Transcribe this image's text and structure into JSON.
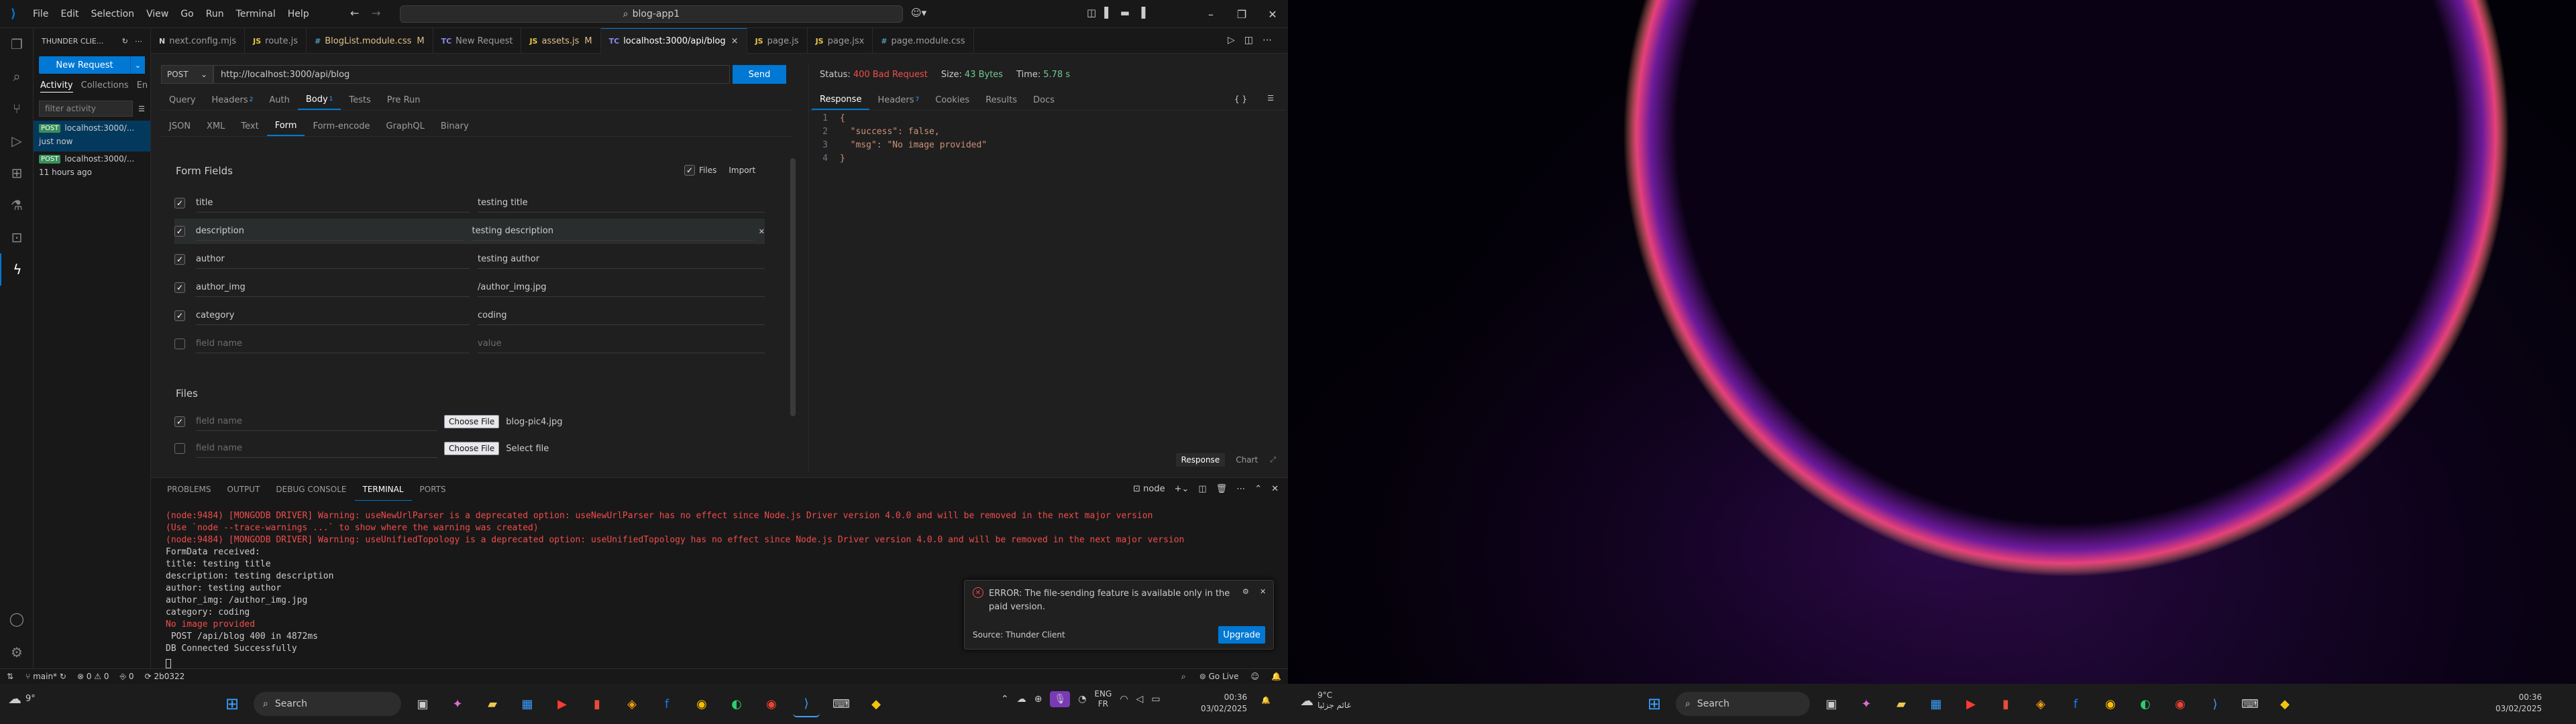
{
  "titlebar": {
    "menus": [
      "File",
      "Edit",
      "Selection",
      "View",
      "Go",
      "Run",
      "Terminal",
      "Help"
    ],
    "search": "blog-app1"
  },
  "sidebar": {
    "header": "THUNDER CLIE...",
    "new_request_label": "New Request",
    "tabs": [
      "Activity",
      "Collections",
      "En"
    ],
    "filter_placeholder": "filter activity",
    "activity": [
      {
        "method": "POST",
        "url": "localhost:3000/...",
        "time": "just now"
      },
      {
        "method": "POST",
        "url": "localhost:3000/...",
        "time": "11 hours ago"
      }
    ]
  },
  "tabs": [
    {
      "icon": "N",
      "label": "next.config.mjs",
      "mod": ""
    },
    {
      "icon": "JS",
      "label": "route.js",
      "mod": ""
    },
    {
      "icon": "#",
      "label": "BlogList.module.css",
      "mod": "M"
    },
    {
      "icon": "TC",
      "label": "New Request",
      "mod": ""
    },
    {
      "icon": "JS",
      "label": "assets.js",
      "mod": "M"
    },
    {
      "icon": "TC",
      "label": "localhost:3000/api/blog",
      "mod": "×"
    },
    {
      "icon": "JS",
      "label": "page.js",
      "mod": ""
    },
    {
      "icon": "JS",
      "label": "page.jsx",
      "mod": ""
    },
    {
      "icon": "#",
      "label": "page.module.css",
      "mod": ""
    }
  ],
  "request": {
    "method": "POST",
    "url": "http://localhost:3000/api/blog",
    "send": "Send",
    "tabs": [
      "Query",
      "Headers",
      "Auth",
      "Body",
      "Tests",
      "Pre Run"
    ],
    "headers_count": "2",
    "body_count": "1",
    "body_types": [
      "JSON",
      "XML",
      "Text",
      "Form",
      "Form-encode",
      "GraphQL",
      "Binary"
    ],
    "form_fields_title": "Form Fields",
    "files_toggle": "Files",
    "import": "Import",
    "fields": [
      {
        "name": "title",
        "value": "testing title",
        "checked": true
      },
      {
        "name": "description",
        "value": "testing description",
        "checked": true
      },
      {
        "name": "author",
        "value": "testing author",
        "checked": true
      },
      {
        "name": "author_img",
        "value": "/author_img.jpg",
        "checked": true
      },
      {
        "name": "category",
        "value": "coding",
        "checked": true
      }
    ],
    "name_placeholder": "field name",
    "value_placeholder": "value",
    "files_title": "Files",
    "choose_file": "Choose File",
    "file1": "blog-pic4.jpg",
    "file2": "Select file"
  },
  "response": {
    "status_label": "Status:",
    "status": "400 Bad Request",
    "size_label": "Size:",
    "size": "43 Bytes",
    "time_label": "Time:",
    "time": "5.78 s",
    "tabs": [
      "Response",
      "Headers",
      "Cookies",
      "Results",
      "Docs"
    ],
    "headers_count": "7",
    "lines": [
      "{",
      "  \"success\": false,",
      "  \"msg\": \"No image provided\"",
      "}"
    ],
    "bottom_tabs": [
      "Response",
      "Chart"
    ]
  },
  "panel": {
    "tabs": [
      "PROBLEMS",
      "OUTPUT",
      "DEBUG CONSOLE",
      "TERMINAL",
      "PORTS"
    ],
    "shell": "node",
    "lines": [
      {
        "text": "(node:9484) [MONGODB DRIVER] Warning: useNewUrlParser is a deprecated option: useNewUrlParser has no effect since Node.js Driver version 4.0.0 and will be removed in the next major version",
        "color": "#f14c4c"
      },
      {
        "text": "(Use `node --trace-warnings ...` to show where the warning was created)",
        "color": "#f14c4c"
      },
      {
        "text": "(node:9484) [MONGODB DRIVER] Warning: useUnifiedTopology is a deprecated option: useUnifiedTopology has no effect since Node.js Driver version 4.0.0 and will be removed in the next major version",
        "color": "#f14c4c"
      },
      {
        "text": "FormData received:",
        "color": "#cccccc"
      },
      {
        "text": "title: testing title",
        "color": "#cccccc"
      },
      {
        "text": "description: testing description",
        "color": "#cccccc"
      },
      {
        "text": "author: testing author",
        "color": "#cccccc"
      },
      {
        "text": "author_img: /author_img.jpg",
        "color": "#cccccc"
      },
      {
        "text": "category: coding",
        "color": "#cccccc"
      },
      {
        "text": "No image provided",
        "color": "#f14c4c"
      },
      {
        "text": " POST /api/blog 400 in 4872ms",
        "color": "#cccccc"
      },
      {
        "text": "DB Connected Successfully",
        "color": "#cccccc"
      }
    ]
  },
  "notification": {
    "message": "ERROR: The file-sending feature is available only in the paid version.",
    "source": "Source: Thunder Client",
    "action": "Upgrade"
  },
  "statusbar": {
    "branch": "main*",
    "errors": "0",
    "warnings": "0",
    "ports": "0",
    "commit": "2b0322",
    "golive": "Go Live"
  },
  "taskbar": {
    "weather": "9°",
    "search": "Search",
    "lang1": "ENG",
    "lang2": "FR",
    "time": "00:36",
    "date": "03/02/2025",
    "weather2_temp": "9°C",
    "weather2_text": "غائم جزئيا",
    "search2": "Search",
    "time2": "00:36",
    "date2": "03/02/2025"
  },
  "colors": {
    "accent": "#0078d4",
    "error": "#f14c4c",
    "success": "#73c991",
    "warning_tab": "#e2c08d"
  }
}
